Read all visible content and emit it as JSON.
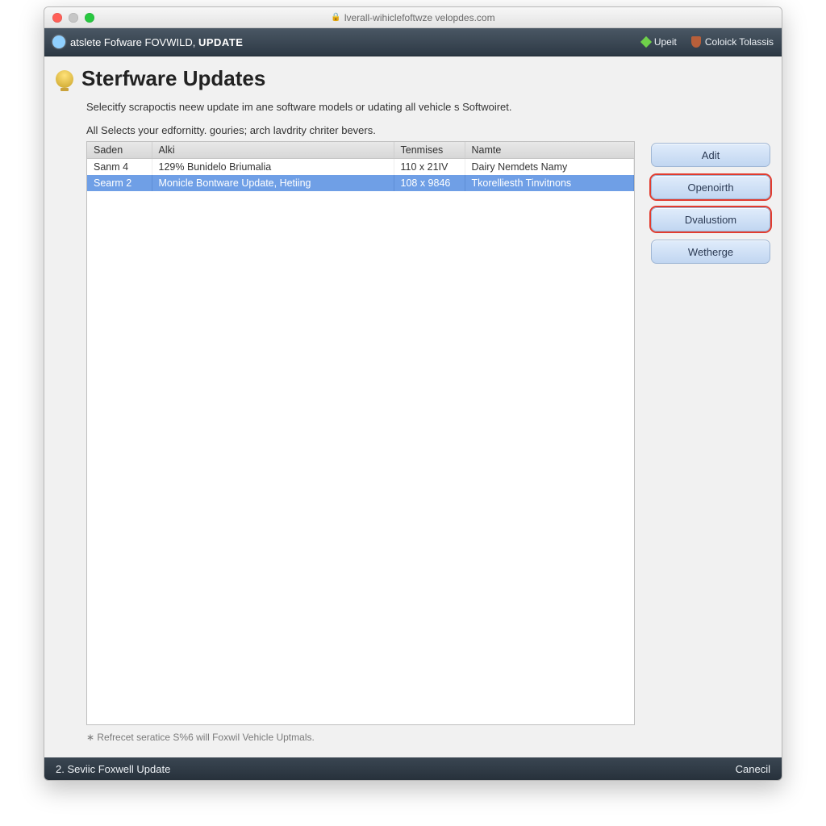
{
  "window": {
    "address": "lverall-wihiclefoftwze velopdes.com"
  },
  "appbar": {
    "title_a": "atslete Fofware",
    "title_b": "FOVWILD,",
    "title_c": "UPDATE",
    "link1": "Upeit",
    "link2": "Coloick Tolassis"
  },
  "page": {
    "heading": "Sterfware Updates",
    "intro": "Selecitfy scrapoctis neew update im ane software models or udating all vehicle s Softwoiret.",
    "sub": "All Selects your edfornitty. gouries; arch lavdrity chriter bevers.",
    "footnote": "∗  Refrecet seratice S%6 will Foxwil Vehicle Uptmals."
  },
  "table": {
    "headers": [
      "Saden",
      "Alki",
      "Tenmises",
      "Namte"
    ],
    "rows": [
      {
        "c1": "Sanm 4",
        "c2": "129% Bunidelo Briumalia",
        "c3": "110 x 21IV",
        "c4": "Dairy Nemdets Namy",
        "selected": false
      },
      {
        "c1": "Searm 2",
        "c2": "Monicle Bontware Update, Hetiing",
        "c3": "108 x 9846",
        "c4": "Tkorelliesth Tinvitnons",
        "selected": true
      }
    ]
  },
  "buttons": {
    "b1": "Adit",
    "b2": "Openoirth",
    "b3": "Dvalustiom",
    "b4": "Wetherge"
  },
  "statusbar": {
    "left": "2. Seviic Foxwell Update",
    "right": "Canecil"
  }
}
